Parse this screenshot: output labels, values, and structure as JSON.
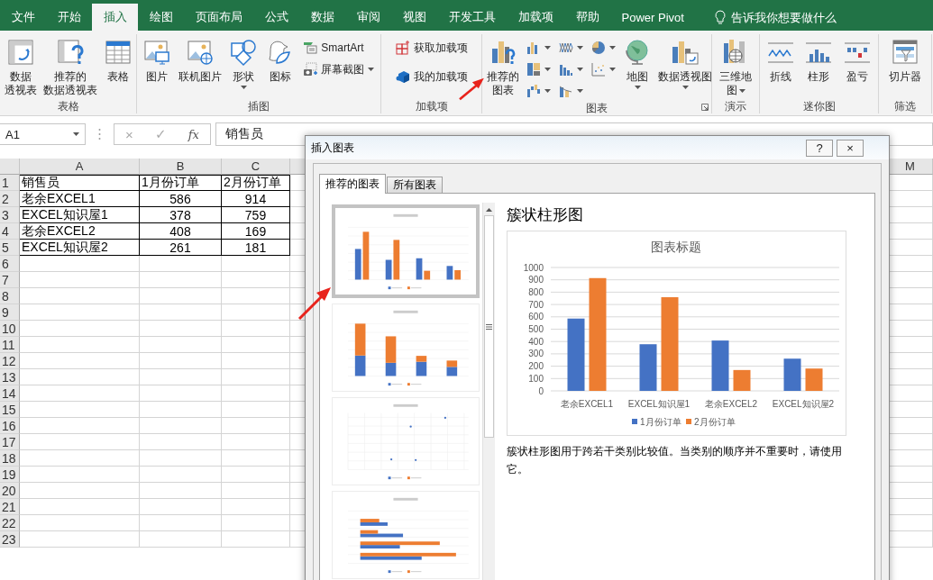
{
  "ribbon_tabs": [
    {
      "label": "文件",
      "selected": false
    },
    {
      "label": "开始",
      "selected": false
    },
    {
      "label": "插入",
      "selected": true
    },
    {
      "label": "绘图",
      "selected": false
    },
    {
      "label": "页面布局",
      "selected": false
    },
    {
      "label": "公式",
      "selected": false
    },
    {
      "label": "数据",
      "selected": false
    },
    {
      "label": "审阅",
      "selected": false
    },
    {
      "label": "视图",
      "selected": false
    },
    {
      "label": "开发工具",
      "selected": false
    },
    {
      "label": "加载项",
      "selected": false
    },
    {
      "label": "帮助",
      "selected": false
    },
    {
      "label": "Power Pivot",
      "selected": false
    }
  ],
  "tell_me": {
    "placeholder": "告诉我你想要做什么"
  },
  "ribbon_groups": [
    {
      "label": "表格",
      "launcher": false,
      "items": [
        {
          "kind": "large",
          "lines": [
            "数据",
            "透视表"
          ],
          "has_menu": false
        },
        {
          "kind": "large",
          "lines": [
            "推荐的",
            "数据透视表"
          ],
          "has_menu": false
        },
        {
          "kind": "large",
          "lines": [
            "表格"
          ],
          "has_menu": false
        }
      ]
    },
    {
      "label": "插图",
      "launcher": false,
      "items": [
        {
          "kind": "large",
          "lines": [
            "图片"
          ],
          "has_menu": false
        },
        {
          "kind": "large",
          "lines": [
            "联机图片"
          ],
          "has_menu": false
        },
        {
          "kind": "large",
          "lines": [
            "形状"
          ],
          "has_menu": true
        },
        {
          "kind": "large",
          "lines": [
            "图标"
          ],
          "has_menu": false
        },
        {
          "kind": "small",
          "lines": [
            "SmartArt"
          ],
          "has_menu": false
        },
        {
          "kind": "small",
          "lines": [
            "屏幕截图"
          ],
          "has_menu": true
        }
      ]
    },
    {
      "label": "加载项",
      "launcher": false,
      "items": [
        {
          "kind": "small",
          "lines": [
            "获取加载项"
          ],
          "has_menu": false
        },
        {
          "kind": "small",
          "lines": [
            "我的加载项"
          ],
          "has_menu": false
        }
      ]
    },
    {
      "label": "图表",
      "launcher": true,
      "items": [
        {
          "kind": "large",
          "lines": [
            "推荐的",
            "图表"
          ],
          "has_menu": false
        },
        {
          "kind": "icon",
          "has_menu": true
        },
        {
          "kind": "icon",
          "has_menu": true
        },
        {
          "kind": "icon",
          "has_menu": true
        },
        {
          "kind": "icon",
          "has_menu": true
        },
        {
          "kind": "icon",
          "has_menu": true
        },
        {
          "kind": "icon",
          "has_menu": true
        },
        {
          "kind": "icon",
          "has_menu": true
        },
        {
          "kind": "icon",
          "has_menu": true
        },
        {
          "kind": "large",
          "lines": [
            "地图"
          ],
          "has_menu": true
        },
        {
          "kind": "large",
          "lines": [
            "数据透视图"
          ],
          "has_menu": true
        }
      ]
    },
    {
      "label": "演示",
      "launcher": false,
      "items": [
        {
          "kind": "large",
          "lines": [
            "三维地",
            "图"
          ],
          "has_menu": true
        }
      ]
    },
    {
      "label": "迷你图",
      "launcher": false,
      "items": [
        {
          "kind": "large",
          "lines": [
            "折线"
          ],
          "has_menu": false
        },
        {
          "kind": "large",
          "lines": [
            "柱形"
          ],
          "has_menu": false
        },
        {
          "kind": "large",
          "lines": [
            "盈亏"
          ],
          "has_menu": false
        }
      ]
    },
    {
      "label": "筛选",
      "launcher": false,
      "items": [
        {
          "kind": "large",
          "lines": [
            "切片器"
          ],
          "has_menu": false
        }
      ]
    }
  ],
  "formula_bar": {
    "name_box": "A1",
    "cancel": "×",
    "enter": "✓",
    "function_label": "fx",
    "formula": "销售员"
  },
  "sheet": {
    "columns": [
      "A",
      "B",
      "C"
    ],
    "far_column": "M",
    "rows": [
      {
        "number": "1",
        "cells": [
          "销售员",
          "1月份订单",
          "2月份订单"
        ]
      },
      {
        "number": "2",
        "cells": [
          "老余EXCEL1",
          "586",
          "914"
        ]
      },
      {
        "number": "3",
        "cells": [
          "EXCEL知识屋1",
          "378",
          "759"
        ]
      },
      {
        "number": "4",
        "cells": [
          "老余EXCEL2",
          "408",
          "169"
        ]
      },
      {
        "number": "5",
        "cells": [
          "EXCEL知识屋2",
          "261",
          "181"
        ]
      },
      {
        "number": "6"
      },
      {
        "number": "7"
      },
      {
        "number": "8"
      },
      {
        "number": "9"
      },
      {
        "number": "10"
      },
      {
        "number": "11"
      },
      {
        "number": "12"
      },
      {
        "number": "13"
      },
      {
        "number": "14"
      },
      {
        "number": "15"
      },
      {
        "number": "16"
      },
      {
        "number": "17"
      },
      {
        "number": "18"
      },
      {
        "number": "19"
      },
      {
        "number": "20"
      },
      {
        "number": "21"
      },
      {
        "number": "22"
      },
      {
        "number": "23"
      }
    ]
  },
  "dialog": {
    "title": "插入图表",
    "help": "?",
    "close": "×",
    "tabs": [
      {
        "label": "推荐的图表",
        "selected": true
      },
      {
        "label": "所有图表",
        "selected": false
      }
    ],
    "thumbnails": [
      {
        "kind": "clustered_column",
        "selected": true
      },
      {
        "kind": "stacked_column",
        "selected": false
      },
      {
        "kind": "scatter",
        "selected": false
      },
      {
        "kind": "clustered_bar",
        "selected": false
      }
    ],
    "preview": {
      "heading": "簇状柱形图",
      "chart_data": {
        "type": "bar",
        "title": "图表标题",
        "categories": [
          "老余EXCEL1",
          "EXCEL知识屋1",
          "老余EXCEL2",
          "EXCEL知识屋2"
        ],
        "series": [
          {
            "name": "1月份订单",
            "color": "#4472c4",
            "values": [
              586,
              378,
              408,
              261
            ]
          },
          {
            "name": "2月份订单",
            "color": "#ed7d31",
            "values": [
              914,
              759,
              169,
              181
            ]
          }
        ],
        "grid": true,
        "legend": "bottom",
        "ylim": [
          0,
          1000
        ],
        "yticks": [
          0,
          100,
          200,
          300,
          400,
          500,
          600,
          700,
          800,
          900,
          1000
        ]
      },
      "description": "簇状柱形图用于跨若干类别比较值。当类别的顺序并不重要时，请使用它。"
    }
  }
}
